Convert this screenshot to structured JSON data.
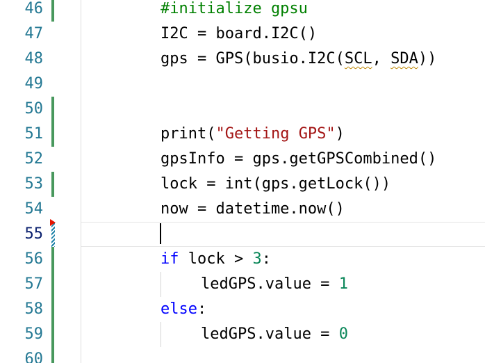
{
  "editor": {
    "lines": [
      {
        "number": "46",
        "gutter": "added",
        "tokens": [
          {
            "text": "#initialize gpsu",
            "type": "comment"
          }
        ]
      },
      {
        "number": "47",
        "gutter": "none",
        "tokens": [
          {
            "text": "I2C = board.I2C()",
            "type": "plain"
          }
        ]
      },
      {
        "number": "48",
        "gutter": "none",
        "tokens": [
          {
            "text": "gps = GPS(busio.I2C(",
            "type": "plain"
          },
          {
            "text": "SCL",
            "type": "warning"
          },
          {
            "text": ", ",
            "type": "plain"
          },
          {
            "text": "SDA",
            "type": "warning"
          },
          {
            "text": "))",
            "type": "plain"
          }
        ]
      },
      {
        "number": "49",
        "gutter": "none",
        "tokens": []
      },
      {
        "number": "50",
        "gutter": "added",
        "tokens": []
      },
      {
        "number": "51",
        "gutter": "added",
        "tokens": [
          {
            "text": "print(",
            "type": "plain"
          },
          {
            "text": "\"Getting GPS\"",
            "type": "string"
          },
          {
            "text": ")",
            "type": "plain"
          }
        ]
      },
      {
        "number": "52",
        "gutter": "none",
        "tokens": [
          {
            "text": "gpsInfo = gps.getGPSCombined()",
            "type": "plain"
          }
        ]
      },
      {
        "number": "53",
        "gutter": "added",
        "tokens": [
          {
            "text": "lock = int(gps.getLock())",
            "type": "plain"
          }
        ]
      },
      {
        "number": "54",
        "gutter": "none",
        "tokens": [
          {
            "text": "now = datetime.now()",
            "type": "plain"
          }
        ]
      },
      {
        "number": "55",
        "gutter": "modified",
        "deleted_marker": true,
        "current": true,
        "tokens": []
      },
      {
        "number": "56",
        "gutter": "added",
        "tokens": [
          {
            "text": "if",
            "type": "keyword"
          },
          {
            "text": " lock > ",
            "type": "plain"
          },
          {
            "text": "3",
            "type": "number"
          },
          {
            "text": ":",
            "type": "plain"
          }
        ]
      },
      {
        "number": "57",
        "gutter": "added",
        "indent": 2,
        "tokens": [
          {
            "text": "ledGPS.value = ",
            "type": "plain"
          },
          {
            "text": "1",
            "type": "number"
          }
        ]
      },
      {
        "number": "58",
        "gutter": "added",
        "tokens": [
          {
            "text": "else",
            "type": "keyword"
          },
          {
            "text": ":",
            "type": "plain"
          }
        ]
      },
      {
        "number": "59",
        "gutter": "added",
        "indent": 2,
        "tokens": [
          {
            "text": "ledGPS.value = ",
            "type": "plain"
          },
          {
            "text": "0",
            "type": "number"
          }
        ]
      },
      {
        "number": "60",
        "gutter": "added",
        "tokens": []
      }
    ],
    "colors": {
      "line_number": "#237893",
      "line_number_active": "#0b216f",
      "gutter_added": "#48985d",
      "gutter_modified": "#1b81a8",
      "gutter_deleted": "#e51400",
      "comment": "#008000",
      "string": "#a31515",
      "keyword": "#0000ff",
      "number": "#098658",
      "warning_squiggle": "#bf8803"
    }
  }
}
